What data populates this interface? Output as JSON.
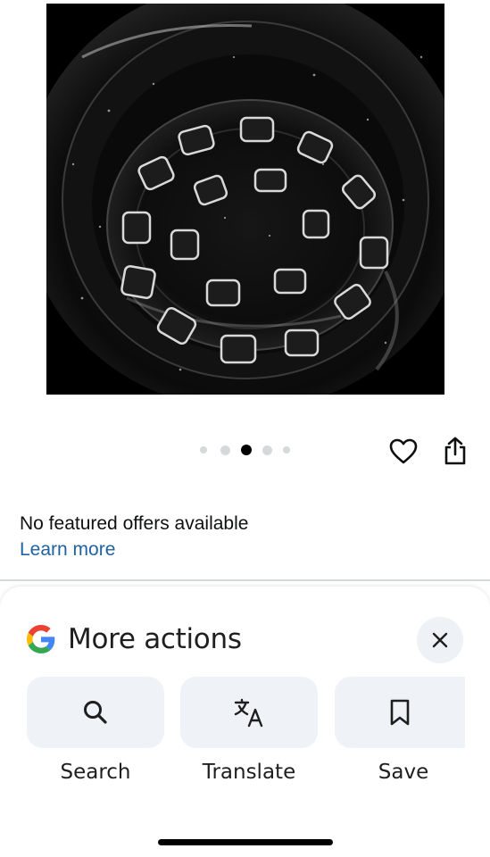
{
  "product": {
    "image_description_icon": "enamel-pot-interior-image",
    "carousel": {
      "total": 5,
      "active_index": 2
    }
  },
  "offers": {
    "status_text": "No featured offers available",
    "learn_more_label": "Learn more"
  },
  "google_sheet": {
    "title": "More actions",
    "actions": [
      {
        "label": "Search",
        "icon": "search-icon"
      },
      {
        "label": "Translate",
        "icon": "translate-icon"
      },
      {
        "label": "Save",
        "icon": "bookmark-icon"
      }
    ]
  },
  "colors": {
    "link": "#2162a1",
    "tile_bg": "#eff3f7",
    "dot_inactive": "#d5d9d9",
    "dot_active": "#000000"
  }
}
